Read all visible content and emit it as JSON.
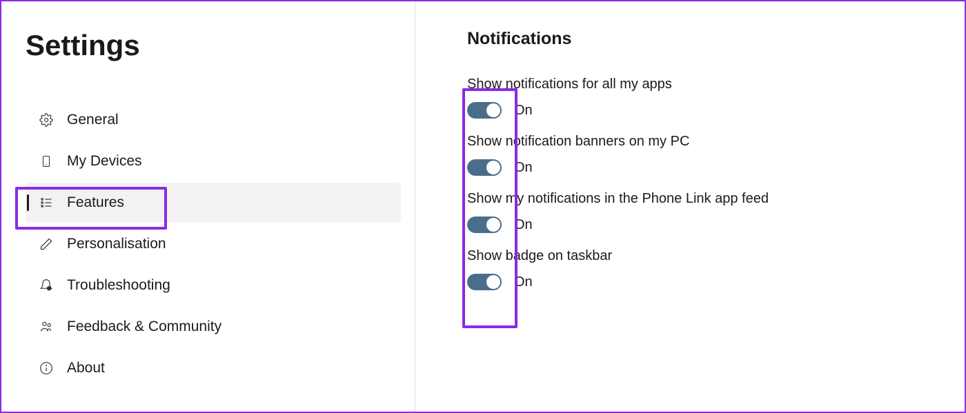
{
  "sidebar": {
    "title": "Settings",
    "items": [
      {
        "label": "General",
        "icon": "gear-icon",
        "active": false
      },
      {
        "label": "My Devices",
        "icon": "phone-icon",
        "active": false
      },
      {
        "label": "Features",
        "icon": "features-icon",
        "active": true
      },
      {
        "label": "Personalisation",
        "icon": "pen-icon",
        "active": false
      },
      {
        "label": "Troubleshooting",
        "icon": "troubleshoot-icon",
        "active": false
      },
      {
        "label": "Feedback & Community",
        "icon": "community-icon",
        "active": false
      },
      {
        "label": "About",
        "icon": "info-icon",
        "active": false
      }
    ]
  },
  "content": {
    "section_title": "Notifications",
    "settings": [
      {
        "label": "Show notifications for all my apps",
        "state": "On",
        "on": true
      },
      {
        "label": "Show notification banners on my PC",
        "state": "On",
        "on": true
      },
      {
        "label": "Show my notifications in the Phone Link app feed",
        "state": "On",
        "on": true
      },
      {
        "label": "Show badge on taskbar",
        "state": "On",
        "on": true
      }
    ]
  }
}
